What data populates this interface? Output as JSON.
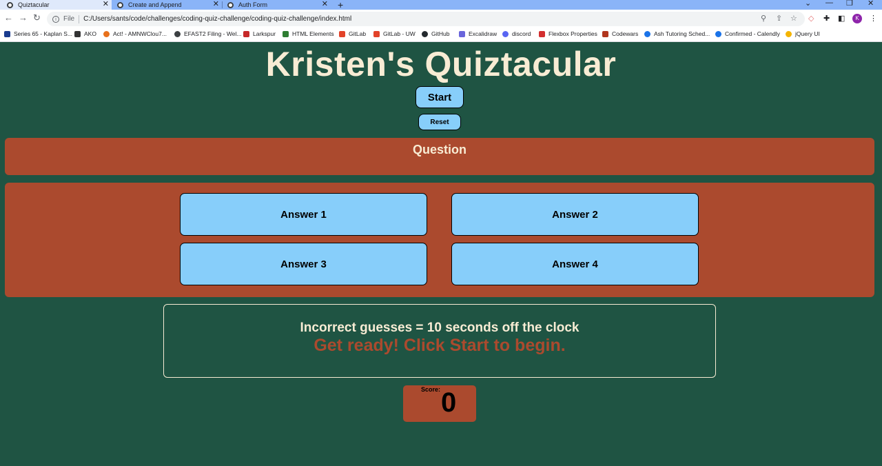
{
  "browser": {
    "tabs": [
      {
        "label": "Quiztacular",
        "active": true
      },
      {
        "label": "Create and Append",
        "active": false
      },
      {
        "label": "Auth Form",
        "active": false
      }
    ],
    "new_tab": "+",
    "window_controls": {
      "minimize": "—",
      "restore": "❐",
      "close": "✕"
    },
    "address": {
      "protocol_label": "File",
      "url": "C:/Users/sants/code/challenges/coding-quiz-challenge/coding-quiz-challenge/index.html"
    },
    "profile_initial": "K",
    "bookmarks": [
      {
        "label": "Series 65 - Kaplan S...",
        "icon_color": "#1a3c8f"
      },
      {
        "label": "AKO",
        "icon_color": "#333333"
      },
      {
        "label": "Act! - AMNWClou7...",
        "icon_color": "#e8711c"
      },
      {
        "label": "EFAST2 Filing - Wel...",
        "icon_color": "#3c4043"
      },
      {
        "label": "Larkspur",
        "icon_color": "#c62828"
      },
      {
        "label": "HTML Elements",
        "icon_color": "#2e7d32"
      },
      {
        "label": "GitLab",
        "icon_color": "#e24329"
      },
      {
        "label": "GitLab - UW",
        "icon_color": "#e24329"
      },
      {
        "label": "GitHub",
        "icon_color": "#24292e"
      },
      {
        "label": "Excalidraw",
        "icon_color": "#6965db"
      },
      {
        "label": "discord",
        "icon_color": "#5865f2"
      },
      {
        "label": "Flexbox Properties",
        "icon_color": "#d32f2f"
      },
      {
        "label": "Codewars",
        "icon_color": "#b1361e"
      },
      {
        "label": "Ash Tutoring Sched...",
        "icon_color": "#1a73e8"
      },
      {
        "label": "Confirmed - Calendly",
        "icon_color": "#1a73e8"
      },
      {
        "label": "jQuery UI",
        "icon_color": "#f4b400"
      }
    ]
  },
  "quiz": {
    "title": "Kristen's Quiztacular",
    "start_label": "Start",
    "reset_label": "Reset",
    "question": "Question",
    "answers": [
      "Answer 1",
      "Answer 2",
      "Answer 3",
      "Answer 4"
    ],
    "rule_text": "Incorrect guesses = 10 seconds off the clock",
    "status_text": "Get ready! Click Start to begin.",
    "score_label": "Score:",
    "score_value": "0"
  },
  "colors": {
    "background": "#1f5443",
    "panel": "#ab4a2e",
    "button": "#87cefa",
    "cream_text": "#f8ecd4"
  }
}
